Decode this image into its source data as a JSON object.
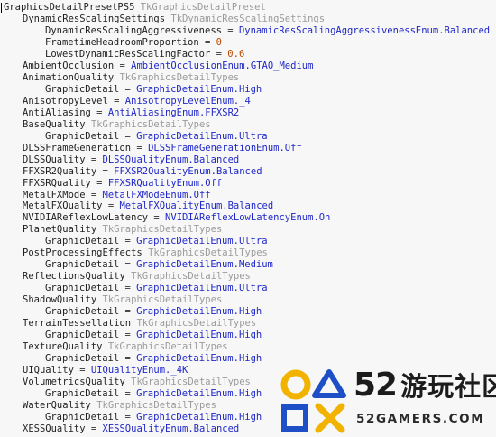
{
  "lines": [
    {
      "indent": 0,
      "key": "GraphicsDetailPresetPS5",
      "type": "TkGraphicsDetailPreset"
    },
    {
      "indent": 1,
      "key": "DynamicResScalingSettings",
      "type": "TkDynamicResScalingSettings"
    },
    {
      "indent": 2,
      "key": "DynamicResScalingAggressiveness",
      "op": " = ",
      "value": "DynamicResScalingAggressivenessEnum.Balanced",
      "kind": "enum"
    },
    {
      "indent": 2,
      "key": "FrametimeHeadroomProportion",
      "op": " = ",
      "value": "0",
      "kind": "num"
    },
    {
      "indent": 2,
      "key": "LowestDynamicResScalingFactor",
      "op": " = ",
      "value": "0.6",
      "kind": "num"
    },
    {
      "indent": 1,
      "key": "AmbientOcclusion",
      "op": " = ",
      "value": "AmbientOcclusionEnum.GTAO_Medium",
      "kind": "enum"
    },
    {
      "indent": 1,
      "key": "AnimationQuality",
      "type": "TkGraphicsDetailTypes"
    },
    {
      "indent": 2,
      "key": "GraphicDetail",
      "op": " = ",
      "value": "GraphicDetailEnum.High",
      "kind": "enum"
    },
    {
      "indent": 1,
      "key": "AnisotropyLevel",
      "op": " = ",
      "value": "AnisotropyLevelEnum._4",
      "kind": "enum"
    },
    {
      "indent": 1,
      "key": "AntiAliasing",
      "op": " = ",
      "value": "AntiAliasingEnum.FFXSR2",
      "kind": "enum"
    },
    {
      "indent": 1,
      "key": "BaseQuality",
      "type": "TkGraphicsDetailTypes"
    },
    {
      "indent": 2,
      "key": "GraphicDetail",
      "op": " = ",
      "value": "GraphicDetailEnum.Ultra",
      "kind": "enum"
    },
    {
      "indent": 1,
      "key": "DLSSFrameGeneration",
      "op": " = ",
      "value": "DLSSFrameGenerationEnum.Off",
      "kind": "enum"
    },
    {
      "indent": 1,
      "key": "DLSSQuality",
      "op": " = ",
      "value": "DLSSQualityEnum.Balanced",
      "kind": "enum"
    },
    {
      "indent": 1,
      "key": "FFXSR2Quality",
      "op": " = ",
      "value": "FFXSR2QualityEnum.Balanced",
      "kind": "enum"
    },
    {
      "indent": 1,
      "key": "FFXSRQuality",
      "op": " = ",
      "value": "FFXSRQualityEnum.Off",
      "kind": "enum"
    },
    {
      "indent": 1,
      "key": "MetalFXMode",
      "op": " = ",
      "value": "MetalFXModeEnum.Off",
      "kind": "enum"
    },
    {
      "indent": 1,
      "key": "MetalFXQuality",
      "op": " = ",
      "value": "MetalFXQualityEnum.Balanced",
      "kind": "enum"
    },
    {
      "indent": 1,
      "key": "NVIDIAReflexLowLatency",
      "op": " = ",
      "value": "NVIDIAReflexLowLatencyEnum.On",
      "kind": "enum"
    },
    {
      "indent": 1,
      "key": "PlanetQuality",
      "type": "TkGraphicsDetailTypes"
    },
    {
      "indent": 2,
      "key": "GraphicDetail",
      "op": " = ",
      "value": "GraphicDetailEnum.Ultra",
      "kind": "enum"
    },
    {
      "indent": 1,
      "key": "PostProcessingEffects",
      "type": "TkGraphicsDetailTypes"
    },
    {
      "indent": 2,
      "key": "GraphicDetail",
      "op": " = ",
      "value": "GraphicDetailEnum.Medium",
      "kind": "enum"
    },
    {
      "indent": 1,
      "key": "ReflectionsQuality",
      "type": "TkGraphicsDetailTypes"
    },
    {
      "indent": 2,
      "key": "GraphicDetail",
      "op": " = ",
      "value": "GraphicDetailEnum.Ultra",
      "kind": "enum"
    },
    {
      "indent": 1,
      "key": "ShadowQuality",
      "type": "TkGraphicsDetailTypes"
    },
    {
      "indent": 2,
      "key": "GraphicDetail",
      "op": " = ",
      "value": "GraphicDetailEnum.High",
      "kind": "enum"
    },
    {
      "indent": 1,
      "key": "TerrainTessellation",
      "type": "TkGraphicsDetailTypes"
    },
    {
      "indent": 2,
      "key": "GraphicDetail",
      "op": " = ",
      "value": "GraphicDetailEnum.High",
      "kind": "enum"
    },
    {
      "indent": 1,
      "key": "TextureQuality",
      "type": "TkGraphicsDetailTypes"
    },
    {
      "indent": 2,
      "key": "GraphicDetail",
      "op": " = ",
      "value": "GraphicDetailEnum.High",
      "kind": "enum"
    },
    {
      "indent": 1,
      "key": "UIQuality",
      "op": " = ",
      "value": "UIQualityEnum._4K",
      "kind": "enum"
    },
    {
      "indent": 1,
      "key": "VolumetricsQuality",
      "type": "TkGraphicsDetailTypes"
    },
    {
      "indent": 2,
      "key": "GraphicDetail",
      "op": " = ",
      "value": "GraphicDetailEnum.High",
      "kind": "enum"
    },
    {
      "indent": 1,
      "key": "WaterQuality",
      "type": "TkGraphicsDetailTypes"
    },
    {
      "indent": 2,
      "key": "GraphicDetail",
      "op": " = ",
      "value": "GraphicDetailEnum.High",
      "kind": "enum"
    },
    {
      "indent": 1,
      "key": "XESSQuality",
      "op": " = ",
      "value": "XESSQualityEnum.Balanced",
      "kind": "enum"
    }
  ],
  "watermark": {
    "number": "52",
    "cn_text": "游玩社区",
    "en_text": "52GAMERS.COM"
  },
  "colors": {
    "background": "#f7f7f7",
    "key": "#1f1f1f",
    "type": "#9b9b9b",
    "enum": "#1f27c9",
    "number": "#b84a00",
    "logo_yellow": "#f2b200",
    "logo_blue": "#1f4fc6"
  }
}
